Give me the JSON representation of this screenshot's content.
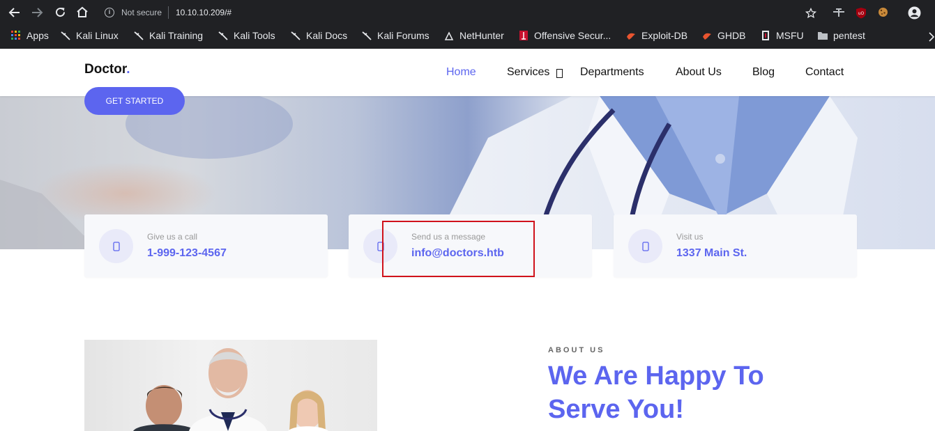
{
  "browser": {
    "security_label": "Not secure",
    "url": "10.10.10.209/#",
    "bookmarks": [
      {
        "label": "Apps",
        "icon": "apps-grid-icon"
      },
      {
        "label": "Kali Linux",
        "icon": "kali-dragon-icon"
      },
      {
        "label": "Kali Training",
        "icon": "kali-dragon-icon"
      },
      {
        "label": "Kali Tools",
        "icon": "kali-dragon-icon"
      },
      {
        "label": "Kali Docs",
        "icon": "kali-dragon-icon"
      },
      {
        "label": "Kali Forums",
        "icon": "kali-dragon-icon"
      },
      {
        "label": "NetHunter",
        "icon": "nethunter-icon"
      },
      {
        "label": "Offensive Secur...",
        "icon": "offsec-icon"
      },
      {
        "label": "Exploit-DB",
        "icon": "exploitdb-icon"
      },
      {
        "label": "GHDB",
        "icon": "exploitdb-icon"
      },
      {
        "label": "MSFU",
        "icon": "msfu-icon"
      },
      {
        "label": "pentest",
        "icon": "folder-icon"
      }
    ]
  },
  "site": {
    "brand": "Doctor",
    "brand_dot": ".",
    "nav": [
      "Home",
      "Services",
      "Departments",
      "About Us",
      "Blog",
      "Contact"
    ],
    "active_nav": "Home",
    "accent_color": "#5c65ef"
  },
  "hero": {
    "cta": "GET STARTED"
  },
  "info_cards": [
    {
      "label": "Give us a call",
      "value": "1-999-123-4567",
      "icon": "phone-icon"
    },
    {
      "label": "Send us a message",
      "value": "info@doctors.htb",
      "icon": "envelope-icon"
    },
    {
      "label": "Visit us",
      "value": "1337 Main St.",
      "icon": "map-marker-icon"
    }
  ],
  "highlight_color": "#d0121b",
  "about": {
    "label": "ABOUT US",
    "title": "We Are Happy To Serve You!"
  }
}
